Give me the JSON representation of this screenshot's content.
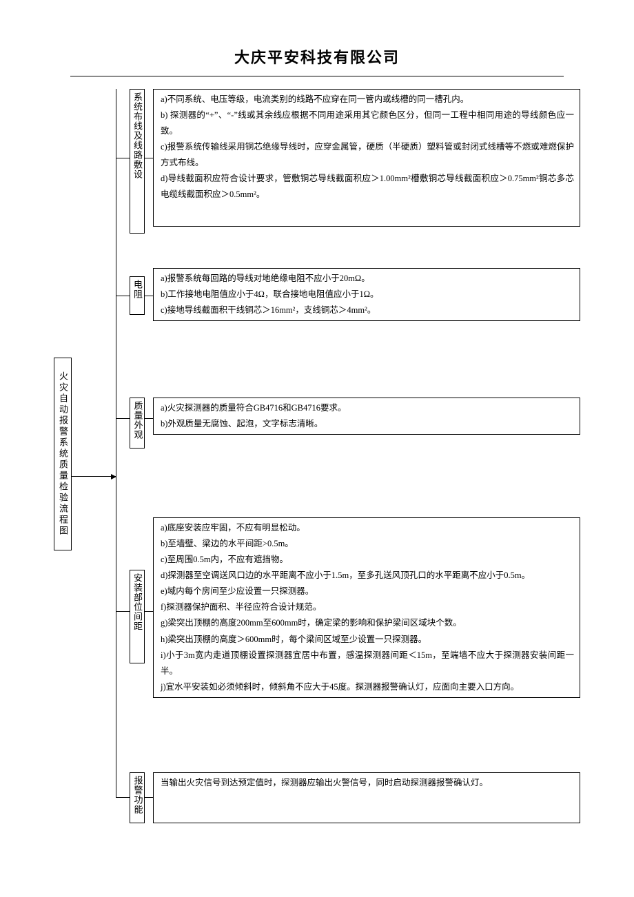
{
  "header": {
    "company": "大庆平安科技有限公司"
  },
  "root": {
    "title": "火灾自动报警系统质量检验流程图"
  },
  "sections": {
    "s1": {
      "label": "系统布线及线路敷设",
      "a": "a)不同系统、电压等级，电流类别的线路不应穿在同一管内或线槽的同一槽孔内。",
      "b": "b) 探测器的“+”、“-”线或其余线应根据不同用途采用其它颜色区分，但同一工程中相同用途的导线颜色应一致。",
      "c": "c)报警系统传输线采用铜芯绝缘导线时，应穿金属管，硬质（半硬质）塑料管或封闭式线槽等不燃或难燃保护方式布线。",
      "d": "d)导线截面积应符合设计要求，管敷铜芯导线截面积应＞1.00mm²槽敷铜芯导线截面积应＞0.75mm²铜芯多芯电缆线截面积应＞0.5mm²。"
    },
    "s2": {
      "label": "电阻",
      "a": "a)报警系统每回路的导线对地绝缘电阻不应小于20mΩ。",
      "b": "b)工作接地电阻值应小于4Ω，联合接地电阻值应小于1Ω。",
      "c": "c)接地导线截面积干线铜芯＞16mm²，支线铜芯＞4mm²。"
    },
    "s3": {
      "label": "质量外观",
      "a": "a)火灾探测器的质量符合GB4716和GB4716要求。",
      "b": "b)外观质量无腐蚀、起泡，文字标志清晰。"
    },
    "s4": {
      "label": "安装部位间距",
      "a": "a)底座安装应牢固，不应有明显松动。",
      "b": "b)至墙壁、梁边的水平间距>0.5m。",
      "c": "c)至周围0.5m内，不应有遮挡物。",
      "d": "d)探测器至空调送风口边的水平距离不应小于1.5m，至多孔送风顶孔口的水平距离不应小于0.5m。",
      "e": "e)域内每个房间至少应设置一只探测器。",
      "f": "f)探测器保护面积、半径应符合设计规范。",
      "g": "g)梁突出顶棚的高度200mm至600mm时，确定梁的影响和保护梁间区域块个数。",
      "h": "h)梁突出顶棚的高度＞600mm时，每个梁间区域至少设置一只探测器。",
      "i": "i)小于3m宽内走道顶棚设置探测器宜居中布置，感温探测器间距＜15m，至端墙不应大于探测器安装间距一半。",
      "j": "j)宜水平安装如必须倾斜时，倾斜角不应大于45度。探测器报警确认灯，应面向主要入口方向。"
    },
    "s5": {
      "label": "报警功能",
      "a": "当输出火灾信号到达预定值时，探测器应输出火警信号，同时启动探测器报警确认灯。"
    }
  }
}
